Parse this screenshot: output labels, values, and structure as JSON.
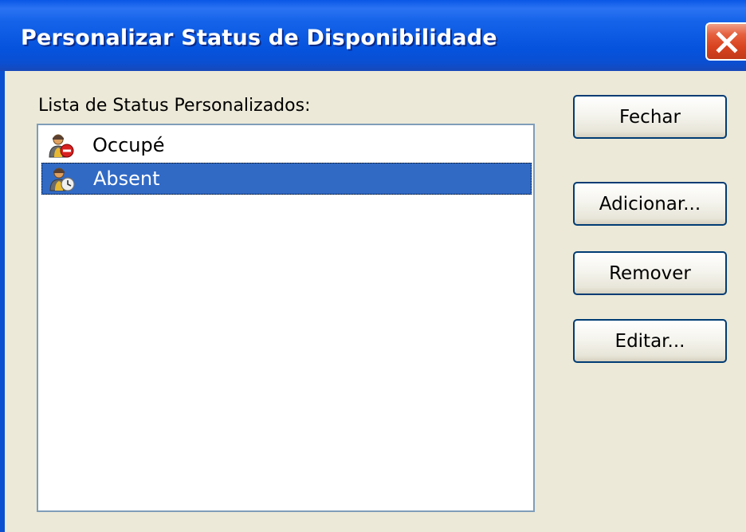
{
  "window": {
    "title": "Personalizar Status de Disponibilidade",
    "close_icon": "close-icon"
  },
  "list": {
    "label": "Lista de Status Personalizados:",
    "items": [
      {
        "label": "Occupé",
        "icon": "user-busy-icon",
        "selected": false
      },
      {
        "label": "Absent",
        "icon": "user-away-icon",
        "selected": true
      }
    ]
  },
  "buttons": {
    "close": "Fechar",
    "add": "Adicionar...",
    "remove": "Remover",
    "edit": "Editar..."
  },
  "colors": {
    "titlebar": "#0553dd",
    "selection": "#316ac5",
    "window_bg": "#ece9d8",
    "close_button": "#d9431f"
  }
}
